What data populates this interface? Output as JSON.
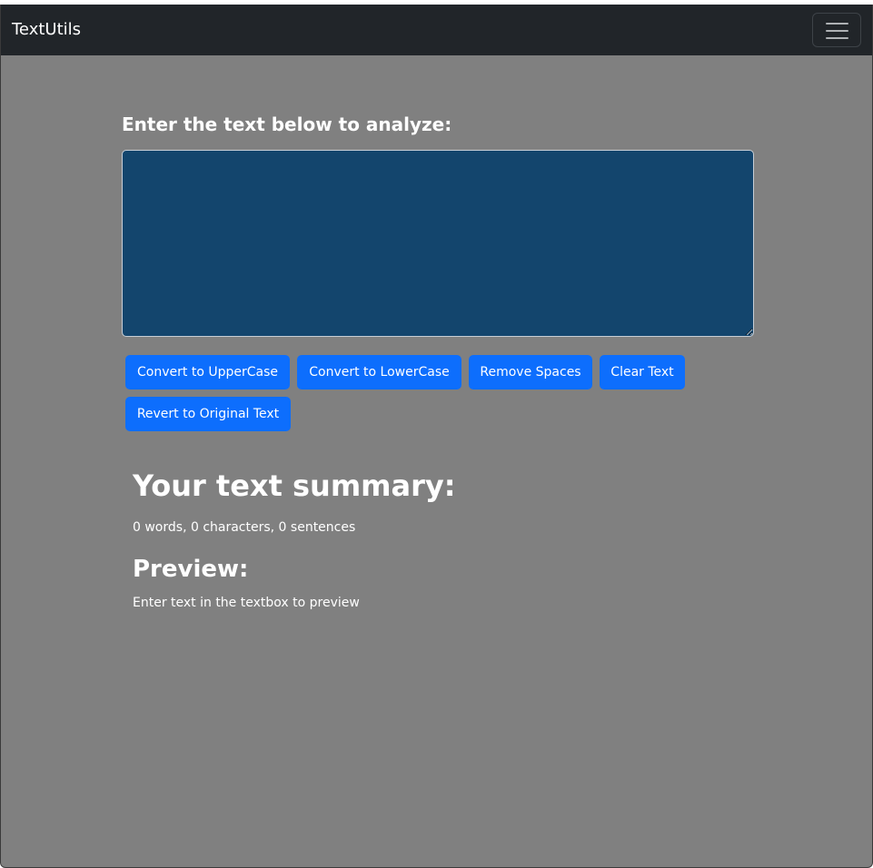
{
  "navbar": {
    "brand": "TextUtils",
    "toggler_icon": "hamburger-menu-icon"
  },
  "form": {
    "heading": "Enter the text below to analyze:",
    "textarea_value": ""
  },
  "buttons": {
    "uppercase": "Convert to UpperCase",
    "lowercase": "Convert to LowerCase",
    "remove_spaces": "Remove Spaces",
    "clear": "Clear Text",
    "revert": "Revert to Original Text"
  },
  "summary": {
    "title": "Your text summary:",
    "stats": "0 words, 0 characters, 0 sentences"
  },
  "preview": {
    "title": "Preview:",
    "text": "Enter text in the textbox to preview"
  },
  "colors": {
    "page_background": "#808080",
    "navbar_background": "#212529",
    "textarea_background": "#13456d",
    "button_primary": "#0d6efd",
    "text": "#ffffff"
  }
}
